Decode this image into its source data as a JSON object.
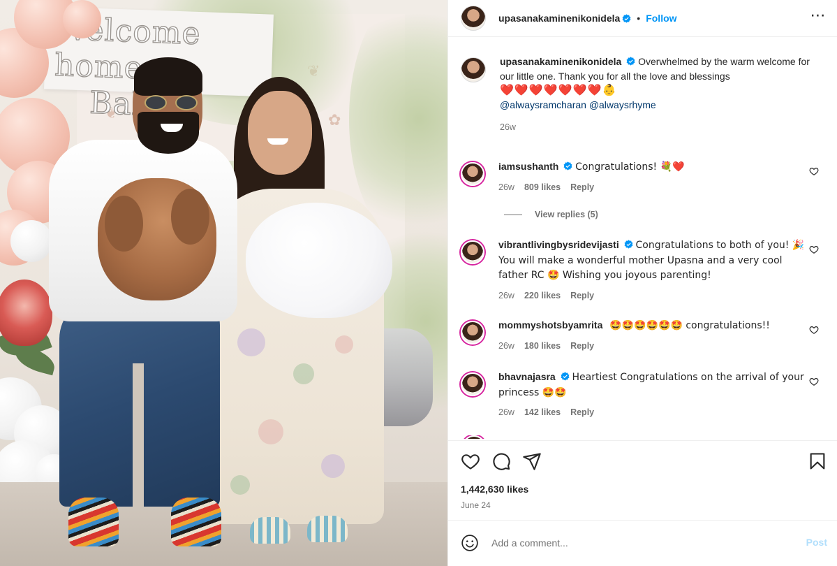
{
  "post": {
    "photo_sign_text": [
      "Welcome home",
      "Bab"
    ],
    "author": {
      "username": "upasanakaminenikonidela",
      "verified": true,
      "follow_label": "Follow",
      "more_label": "⋯"
    },
    "caption": {
      "text": "Overwhelmed by the warm welcome for our little one. Thank you for all the love and blessings",
      "emoji_line": "❤️❤️❤️❤️❤️❤️❤️👶",
      "mention1": "@alwaysramcharan",
      "mention2": "@alwaysrhyme",
      "age": "26w"
    },
    "comments": [
      {
        "username": "iamsushanth",
        "verified": true,
        "text": "Congratulations! 💐❤️",
        "age": "26w",
        "likes": "809 likes",
        "reply": "Reply",
        "view_replies": "View replies (5)"
      },
      {
        "username": "vibrantlivingbysridevijasti",
        "verified": true,
        "text": "Congratulations to both of you! 🎉You will make a wonderful mother Upasna and a very cool father RC 🤩 Wishing you joyous parenting!",
        "age": "26w",
        "likes": "220 likes",
        "reply": "Reply"
      },
      {
        "username": "mommyshotsbyamrita",
        "verified": false,
        "text": "🤩🤩🤩🤩🤩🤩 congratulations!!",
        "age": "26w",
        "likes": "180 likes",
        "reply": "Reply"
      },
      {
        "username": "bhavnajasra",
        "verified": true,
        "text": "Heartiest Congratulations on the arrival of your princess 🤩🤩",
        "age": "26w",
        "likes": "142 likes",
        "reply": "Reply"
      }
    ],
    "likes_count": "1,442,630 likes",
    "date": "June 24",
    "add_comment_placeholder": "Add a comment...",
    "post_label": "Post",
    "icons": [
      "heart-icon",
      "comment-icon",
      "share-icon",
      "bookmark-icon",
      "emoji-icon",
      "verified-badge-icon"
    ],
    "colors": {
      "link": "#0095f6",
      "muted": "#737373",
      "text": "#262626",
      "heart": "#ed1c24",
      "verified": "#0095f6"
    }
  }
}
